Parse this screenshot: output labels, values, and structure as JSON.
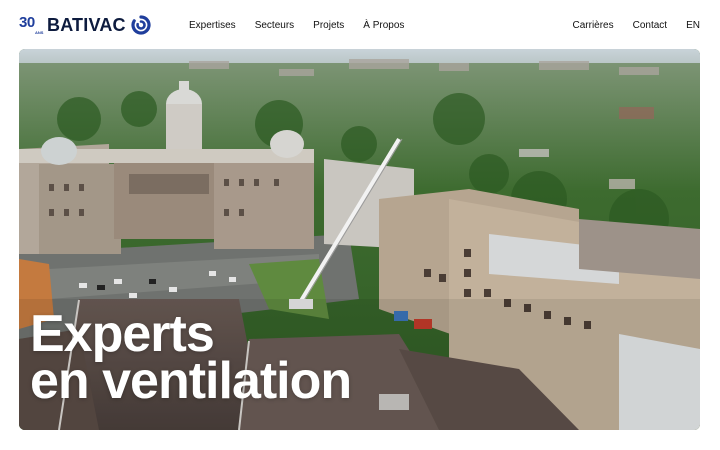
{
  "brand": {
    "anniversary_number": "30",
    "anniversary_suffix": "ANS",
    "name": "BATIVAC",
    "colors": {
      "navy": "#0d1b3e",
      "accent": "#1f3e9c"
    },
    "mark_icon": "bativac-swirl-logo"
  },
  "nav": {
    "primary": [
      {
        "label": "Expertises"
      },
      {
        "label": "Secteurs"
      },
      {
        "label": "Projets"
      },
      {
        "label": "À Propos"
      }
    ],
    "secondary": [
      {
        "label": "Carrières"
      },
      {
        "label": "Contact"
      },
      {
        "label": "EN"
      }
    ]
  },
  "hero": {
    "title_line1": "Experts",
    "title_line2": "en ventilation",
    "image": "aerial-photo-city-buildings-crane"
  }
}
